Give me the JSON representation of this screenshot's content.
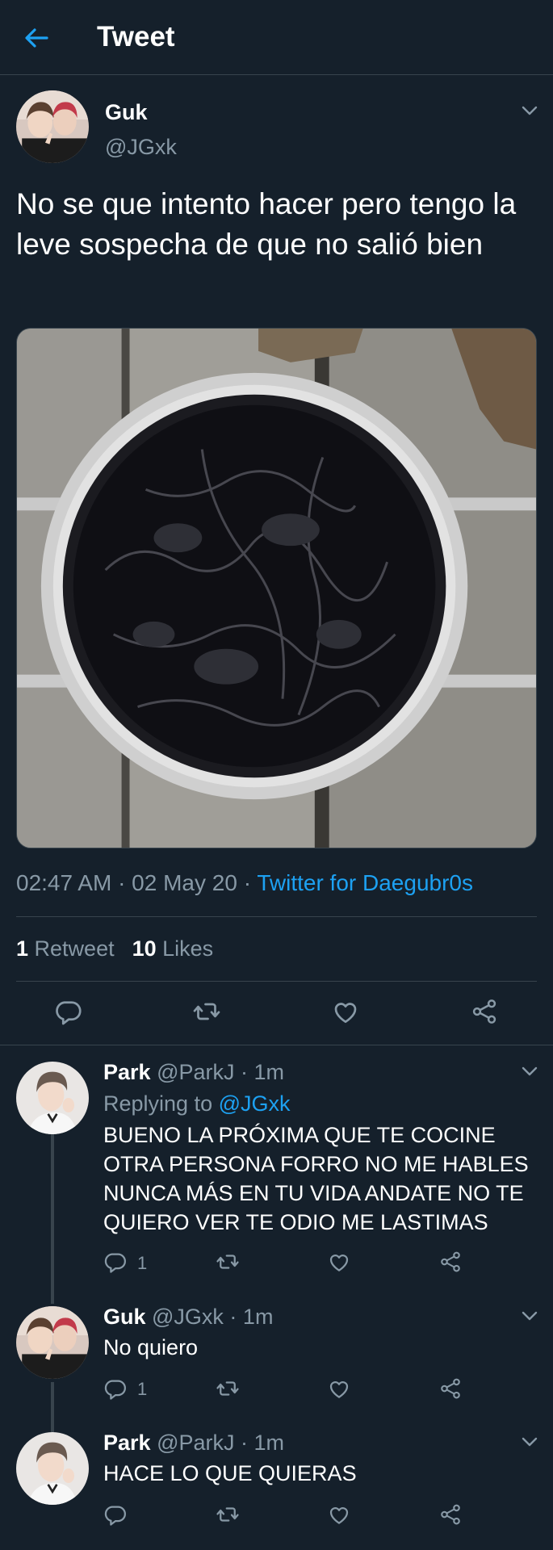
{
  "header": {
    "title": "Tweet",
    "back_icon": "arrow-left-icon"
  },
  "colors": {
    "background": "#15202b",
    "accent": "#1da1f2",
    "muted": "#8899a6",
    "divider": "#38444d"
  },
  "tweet": {
    "name": "Guk",
    "handle": "@JGxk",
    "text": "No se que intento hacer pero tengo la leve sospecha de que no salió bien",
    "time": "02:47 AM · 02 May 20 · ",
    "source": "Twitter for Daegubr0s",
    "retweet_count": "1",
    "retweet_label": " Retweet",
    "like_count": "10",
    "like_label": " Likes"
  },
  "replies": [
    {
      "name": "Park",
      "handle_time": " @ParkJ · 1m",
      "replying_prefix": "Replying to ",
      "replying_to": "@JGxk",
      "text": "BUENO LA PRÓXIMA QUE TE COCINE OTRA PERSONA FORRO NO ME HABLES NUNCA MÁS EN TU VIDA ANDATE NO TE QUIERO VER TE ODIO ME LASTIMAS",
      "reply_count": "1"
    },
    {
      "name": "Guk",
      "handle_time": " @JGxk · 1m",
      "text": "No quiero",
      "reply_count": "1"
    },
    {
      "name": "Park",
      "handle_time": " @ParkJ · 1m",
      "text": "HACE LO QUE QUIERAS"
    }
  ]
}
